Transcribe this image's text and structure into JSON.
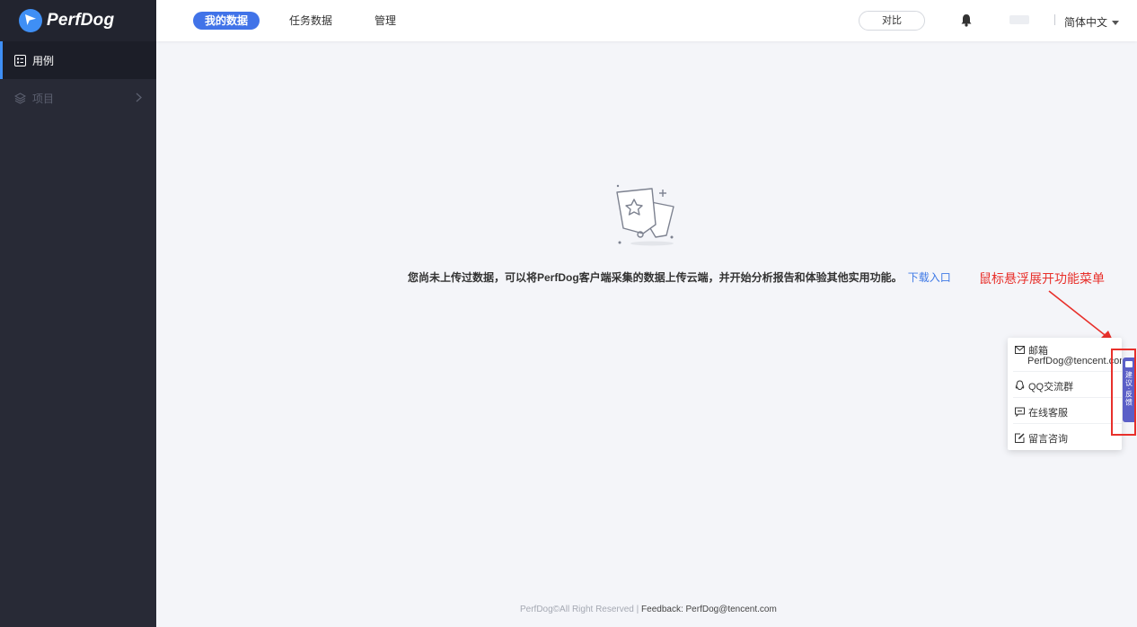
{
  "app": {
    "name": "PerfDog"
  },
  "sidebar": {
    "items": [
      {
        "label": "用例",
        "icon": "list-icon",
        "active": true
      },
      {
        "label": "项目",
        "icon": "layers-icon",
        "active": false
      }
    ]
  },
  "topbar": {
    "tabs": [
      {
        "label": "我的数据",
        "active": true
      },
      {
        "label": "任务数据",
        "active": false
      },
      {
        "label": "管理",
        "active": false
      }
    ],
    "compare_label": "对比",
    "language": "简体中文"
  },
  "empty_state": {
    "message": "您尚未上传过数据，可以将PerfDog客户端采集的数据上传云端，并开始分析报告和体验其他实用功能。",
    "link_label": "下载入口"
  },
  "annotation": {
    "text": "鼠标悬浮展开功能菜单",
    "color": "#e8302b"
  },
  "float_menu": {
    "items": [
      {
        "label": "邮箱",
        "sub": "PerfDog@tencent.com",
        "icon": "mail-icon"
      },
      {
        "label": "QQ交流群",
        "icon": "qq-icon"
      },
      {
        "label": "在线客服",
        "icon": "chat-icon"
      },
      {
        "label": "留言咨询",
        "icon": "edit-icon"
      }
    ]
  },
  "side_tab": {
    "label": "建议·反馈"
  },
  "footer": {
    "copyright": "PerfDog©All Right Reserved",
    "separator": " | ",
    "feedback": "Feedback: PerfDog@tencent.com"
  },
  "colors": {
    "accent": "#4173e8",
    "sidebar_bg": "#282a36",
    "page_bg": "#f4f5f9",
    "side_tab": "#5b5fc7"
  }
}
